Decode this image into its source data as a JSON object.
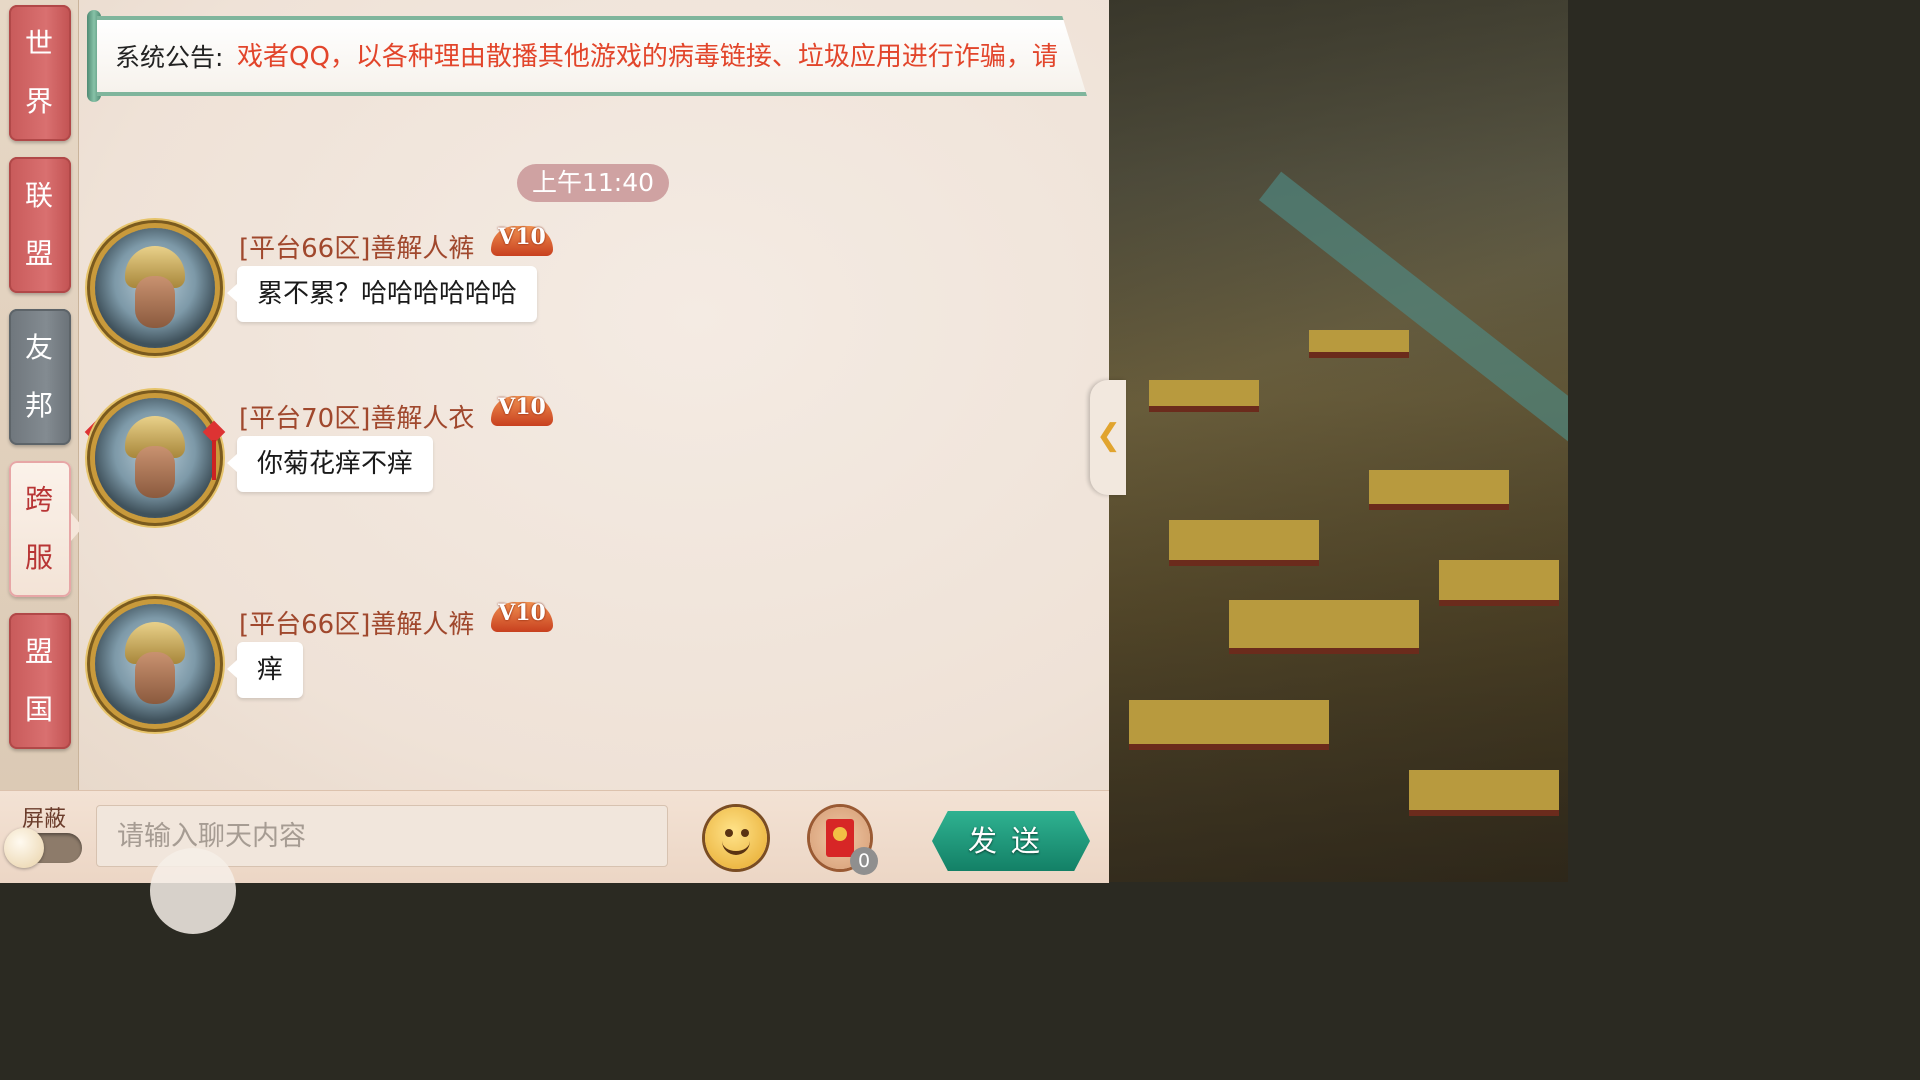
{
  "tabs": [
    {
      "chars": [
        "世",
        "界"
      ]
    },
    {
      "chars": [
        "联",
        "盟"
      ]
    },
    {
      "chars": [
        "友",
        "邦"
      ]
    },
    {
      "chars": [
        "跨",
        "服"
      ]
    },
    {
      "chars": [
        "盟",
        "国"
      ]
    }
  ],
  "notice": {
    "label": "系统公告:",
    "text": "戏者QQ，以各种理由散播其他游戏的病毒链接、垃圾应用进行诈骗，请"
  },
  "timestamp": "上午11:40",
  "messages": [
    {
      "name": "[平台66区]善解人裤",
      "vip": "V10",
      "text": "累不累？哈哈哈哈哈哈"
    },
    {
      "name": "[平台70区]善解人衣",
      "vip": "V10",
      "text": "你菊花痒不痒"
    },
    {
      "name": "[平台66区]善解人裤",
      "vip": "V10",
      "text": "痒"
    }
  ],
  "input": {
    "shield_label": "屏蔽",
    "placeholder": "请输入聊天内容",
    "redpacket_count": "0",
    "send_label": "发送"
  },
  "colors": {
    "accent_red": "#c85a5a",
    "notice_red": "#e2452b",
    "send_green": "#1f9a7b"
  }
}
